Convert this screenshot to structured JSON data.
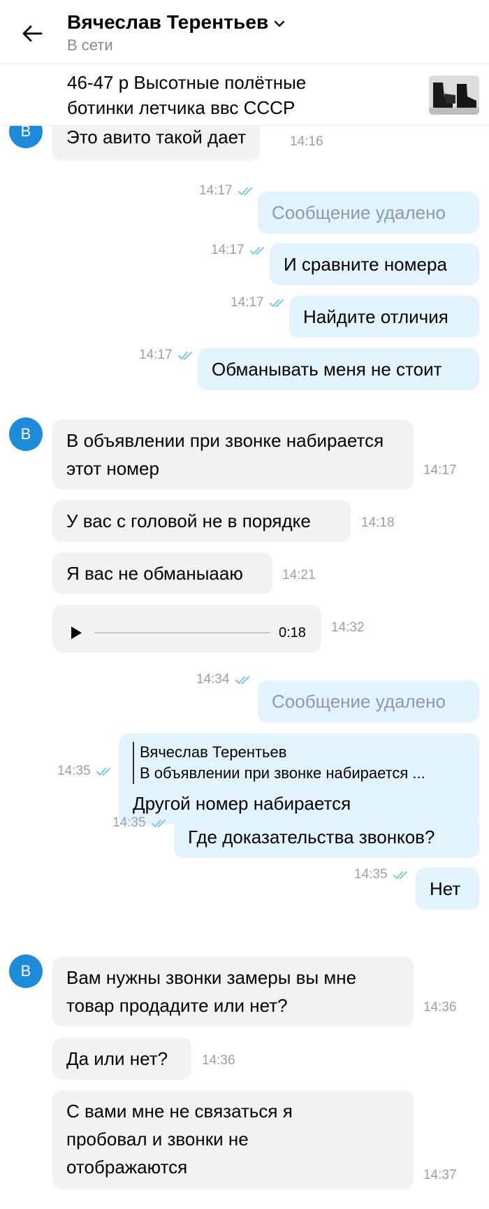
{
  "header": {
    "contact_name": "Вячеслав Терентьев",
    "status": "В сети",
    "icons": {
      "back": "arrow-left-icon",
      "expand": "chevron-down-icon"
    }
  },
  "product": {
    "title": "46-47 р Высотные полётные ботинки летчика ввс СССР",
    "thumbnail": "boots-photo"
  },
  "contact_avatar_letter": "В",
  "colors": {
    "avatar": "#1d8bd8",
    "incoming_bubble": "#f2f2f2",
    "outgoing_bubble": "#e3f3fd",
    "read_ticks": "#7ec6ec"
  },
  "messages": [
    {
      "dir": "in",
      "text": "Это авито такой дает",
      "time": "14:16"
    },
    {
      "dir": "out",
      "text": "Сообщение удалено",
      "time": "14:17",
      "deleted": true
    },
    {
      "dir": "out",
      "text": "И сравните номера",
      "time": "14:17"
    },
    {
      "dir": "out",
      "text": "Найдите отличия",
      "time": "14:17"
    },
    {
      "dir": "out",
      "text": "Обманывать меня не стоит",
      "time": "14:17"
    },
    {
      "dir": "in",
      "text": "В объявлении при звонке набирается этот номер",
      "time": "14:17"
    },
    {
      "dir": "in",
      "text": "У вас с головой не в порядке",
      "time": "14:18"
    },
    {
      "dir": "in",
      "text": "Я вас не обманыааю",
      "time": "14:21"
    },
    {
      "dir": "in",
      "type": "voice",
      "duration": "0:18",
      "time": "14:32"
    },
    {
      "dir": "out",
      "text": "Сообщение удалено",
      "time": "14:34",
      "deleted": true
    },
    {
      "dir": "out",
      "text": "Другой номер набирается",
      "time": "14:35",
      "reply": {
        "author": "Вячеслав Терентьев",
        "text": "В объявлении при звонке набирается ..."
      }
    },
    {
      "dir": "out",
      "text": "Где доказательства звонков?",
      "time": "14:35"
    },
    {
      "dir": "out",
      "text": "Нет",
      "time": "14:35"
    },
    {
      "dir": "in",
      "text": "Вам нужны звонки замеры  вы мне товар продадите или нет?",
      "time": "14:36"
    },
    {
      "dir": "in",
      "text": "Да или нет?",
      "time": "14:36"
    },
    {
      "dir": "in",
      "text": "С вами мне не связаться я пробовал и звонки не отображаются",
      "time": "14:37"
    }
  ]
}
